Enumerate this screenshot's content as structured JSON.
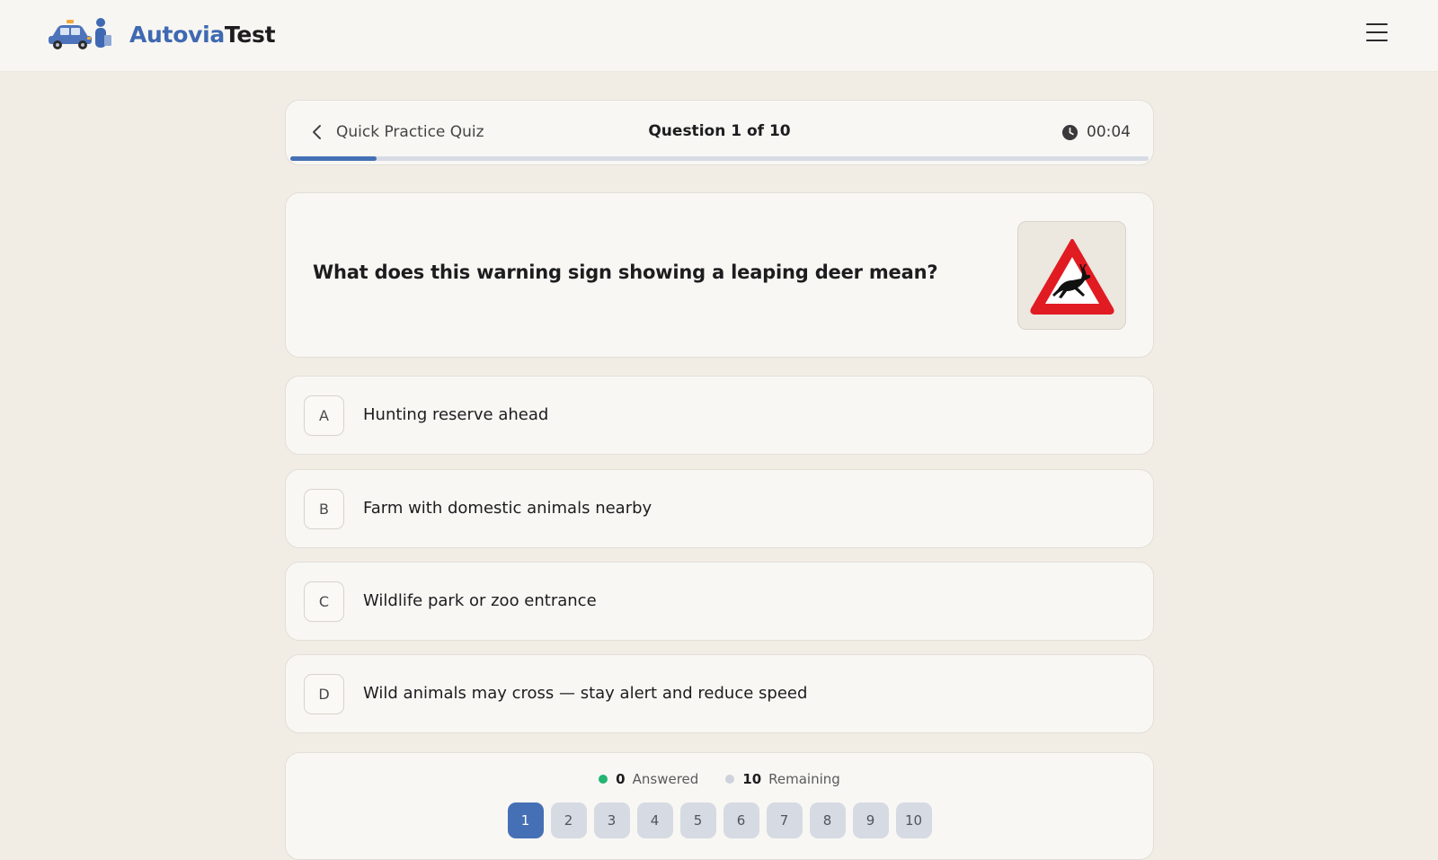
{
  "brand": {
    "name_part1": "Autovia",
    "name_part2": "Test"
  },
  "header": {
    "menu_icon": "hamburger-menu-icon"
  },
  "quiz": {
    "back_label": "Quick Practice Quiz",
    "counter": "Question 1 of 10",
    "timer": "00:04",
    "progress": 0.1,
    "accent_color": "#4670b5"
  },
  "question": {
    "text": "What does this warning sign showing a leaping deer mean?",
    "image": "deer-crossing-warning-sign"
  },
  "options": [
    {
      "letter": "A",
      "text": "Hunting reserve ahead"
    },
    {
      "letter": "B",
      "text": "Farm with domestic animals nearby"
    },
    {
      "letter": "C",
      "text": "Wildlife park or zoo entrance"
    },
    {
      "letter": "D",
      "text": "Wild animals may cross — stay alert and reduce speed"
    }
  ],
  "status": {
    "answered_count": "0",
    "answered_label": "Answered",
    "remaining_count": "10",
    "remaining_label": "Remaining",
    "answered_color": "#22b573",
    "remaining_color": "#cdd2db"
  },
  "pages": [
    "1",
    "2",
    "3",
    "4",
    "5",
    "6",
    "7",
    "8",
    "9",
    "10"
  ],
  "current_page": "1"
}
